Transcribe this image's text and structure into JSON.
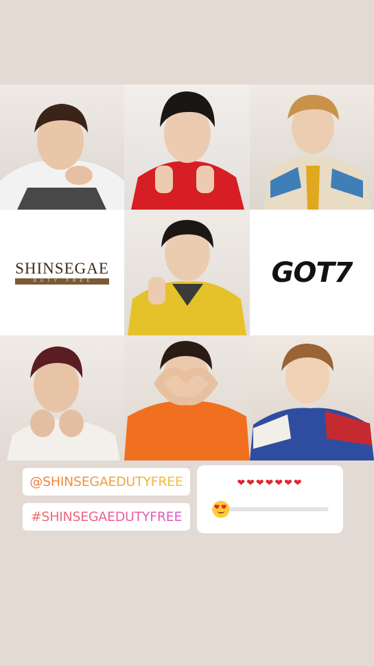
{
  "grid": {
    "tiles": [
      {
        "kind": "photo",
        "subject": "member-1",
        "shirt": "#f2f2f2",
        "hair": "#3a2418"
      },
      {
        "kind": "photo",
        "subject": "member-2",
        "shirt": "#d81e25",
        "hair": "#1a1614"
      },
      {
        "kind": "photo",
        "subject": "member-3",
        "shirt": "#3f7fb8",
        "hair": "#c9924a"
      },
      {
        "kind": "logo",
        "brand": "SHINSEGAE",
        "sub": "DUTY FREE"
      },
      {
        "kind": "photo",
        "subject": "member-5",
        "shirt": "#e6c22a",
        "hair": "#1c1715"
      },
      {
        "kind": "logo",
        "brand": "GOT7"
      },
      {
        "kind": "photo",
        "subject": "member-7",
        "shirt": "#f3f0ec",
        "hair": "#5a1d22"
      },
      {
        "kind": "photo",
        "subject": "member-8",
        "shirt": "#f0701f",
        "hair": "#2a1b15"
      },
      {
        "kind": "photo",
        "subject": "member-9",
        "shirt": "#c52a30",
        "hair": "#9a6436"
      }
    ]
  },
  "logos": {
    "shinsegae_name": "SHINSEGAE",
    "shinsegae_sub": "DUTY FREE",
    "got7": "GOT7"
  },
  "stickers": {
    "mention": "@SHINSEGAEDUTYFREE",
    "hashtag": "#SHINSEGAEDUTYFREE"
  },
  "slider": {
    "hearts": "❤❤❤❤❤❤❤",
    "emoji": "heart-eyes-emoji",
    "value": 0.02
  },
  "colors": {
    "background": "#e3dad3",
    "mention_gradient": [
      "#f07a3a",
      "#f4c33d"
    ],
    "hashtag_gradient": [
      "#f06a6a",
      "#d85bc5"
    ],
    "heart": "#e0242f"
  }
}
